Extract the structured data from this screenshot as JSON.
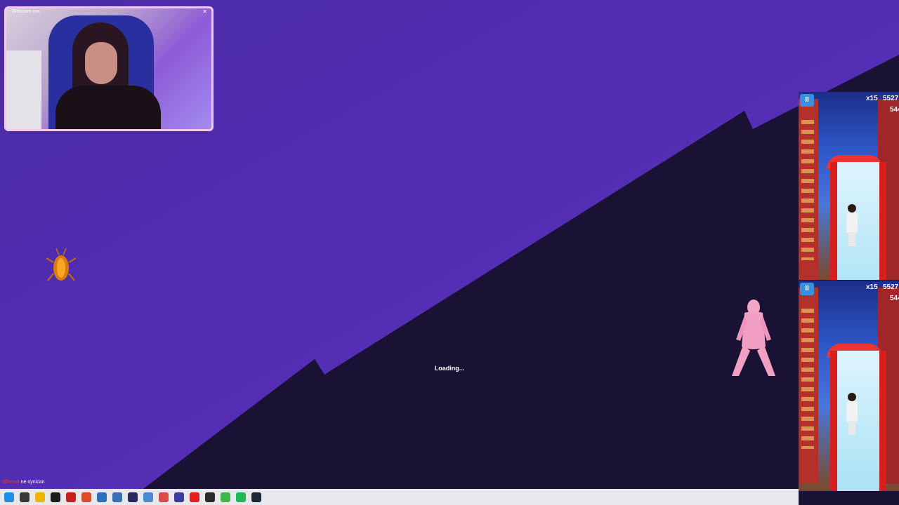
{
  "webcam": {
    "title": "Webcam xxx",
    "close_glyph": "✕"
  },
  "loading_text": "Loading...",
  "game_panels": [
    {
      "pause_glyph": "II",
      "multiplier": "x15",
      "score": "5527",
      "score_secondary": "544"
    },
    {
      "pause_glyph": "II",
      "multiplier": "x15",
      "score": "5527",
      "score_secondary": "544"
    }
  ],
  "chat": {
    "username": "dResult",
    "message": "ne oynican"
  },
  "taskbar": {
    "icons": [
      {
        "name": "windows-start-icon",
        "color": "#1f8fe0"
      },
      {
        "name": "search-icon",
        "color": "#3a3a3a"
      },
      {
        "name": "file-explorer-icon",
        "color": "#f0b400"
      },
      {
        "name": "obs-icon",
        "color": "#1c1c1c"
      },
      {
        "name": "app-red-icon",
        "color": "#c71f1f"
      },
      {
        "name": "browser-icon",
        "color": "#e04a2a"
      },
      {
        "name": "photo-app-icon",
        "color": "#2d6fb8"
      },
      {
        "name": "window-icon",
        "color": "#3a6fb0"
      },
      {
        "name": "adobe-icon",
        "color": "#2a2a5a"
      },
      {
        "name": "doc-icon",
        "color": "#4a8ad0"
      },
      {
        "name": "chrome-icon",
        "color": "#d94a4a"
      },
      {
        "name": "discord-icon",
        "color": "#3a3aa0"
      },
      {
        "name": "opera-icon",
        "color": "#e02020"
      },
      {
        "name": "epic-icon",
        "color": "#2a2a2a"
      },
      {
        "name": "game-green-icon",
        "color": "#3fb54a"
      },
      {
        "name": "spotify-icon",
        "color": "#1db954"
      },
      {
        "name": "steam-icon",
        "color": "#1b2838"
      }
    ]
  },
  "colors": {
    "background_light": "#5a2fb8",
    "background_dark": "#1a1235",
    "webcam_border": "#f3c9ef"
  }
}
